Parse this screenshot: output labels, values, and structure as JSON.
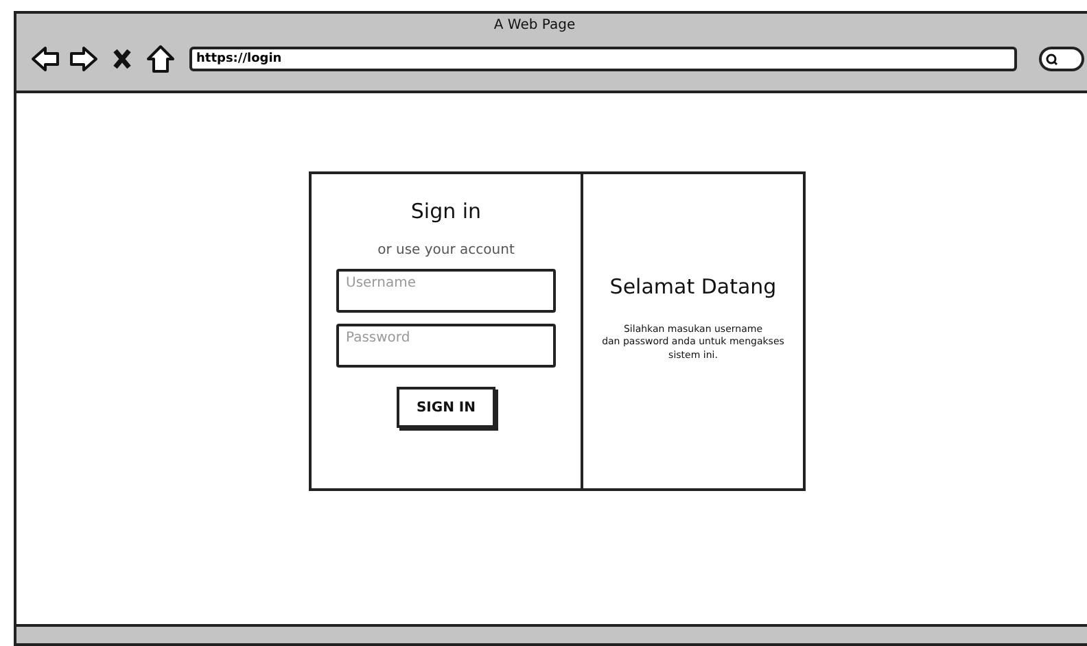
{
  "window": {
    "title": "A Web Page"
  },
  "toolbar": {
    "nav_buttons": [
      {
        "kind": "back"
      },
      {
        "kind": "forward"
      },
      {
        "kind": "stop"
      },
      {
        "kind": "home"
      }
    ],
    "address": "https://login"
  },
  "login": {
    "title": "Sign in",
    "subtitle": "or use your account",
    "fields": [
      {
        "placeholder": "Username"
      },
      {
        "placeholder": "Password"
      }
    ],
    "button": "SIGN IN"
  },
  "welcome": {
    "title": "Selamat Datang",
    "text": "Silahkan masukan username\ndan password anda untuk mengakses\nsistem ini."
  }
}
